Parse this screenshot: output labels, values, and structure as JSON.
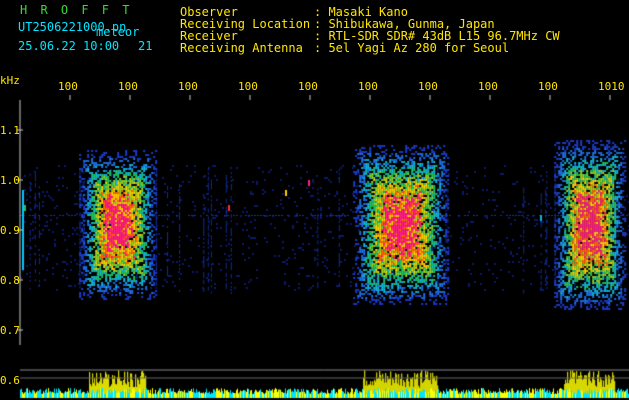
{
  "header": {
    "logo": "H R O F F T",
    "filename": "UT2506221000.pn",
    "meteor_label": "meteor",
    "datetime": "25.06.22 10:00",
    "meteor_count": "21",
    "fields": [
      {
        "label": "Observer",
        "value": ": Masaki Kano"
      },
      {
        "label": "Receiving Location",
        "value": ": Shibukawa, Gunma, Japan"
      },
      {
        "label": "Receiver",
        "value": ": RTL-SDR SDR# 43dB L15 96.7MHz CW"
      },
      {
        "label": "Receiving Antenna",
        "value": ": 5el Yagi Az 280 for Seoul"
      }
    ]
  },
  "colors": {
    "text_yellow": "#ffe600",
    "text_green": "#33dd33",
    "text_cyan": "#00e5ff",
    "background": "#000000"
  },
  "chart_data": {
    "type": "heatmap",
    "ylabel": "kHz",
    "y_ticks": [
      "1.1",
      "1.0",
      "0.9",
      "0.8",
      "0.7"
    ],
    "x_ticks": [
      "100",
      "100",
      "100",
      "100",
      "100",
      "100",
      "100",
      "100",
      "100",
      "1010"
    ],
    "lower_panel_label": "0.6",
    "bursts": [
      {
        "time_fraction": [
          0.13,
          0.19
        ],
        "freq_khz": [
          0.78,
          1.04
        ],
        "intensity": "high"
      },
      {
        "time_fraction": [
          0.58,
          0.67
        ],
        "freq_khz": [
          0.77,
          1.05
        ],
        "intensity": "high"
      },
      {
        "time_fraction": [
          0.91,
          0.96
        ],
        "freq_khz": [
          0.76,
          1.06
        ],
        "intensity": "high"
      }
    ]
  }
}
